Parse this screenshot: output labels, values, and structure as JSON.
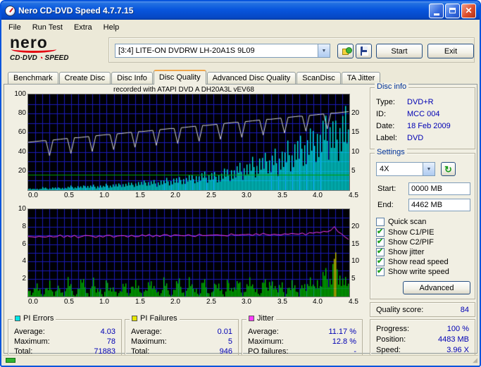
{
  "window": {
    "title": "Nero CD-DVD Speed 4.7.7.15"
  },
  "menu": {
    "items": [
      "File",
      "Run Test",
      "Extra",
      "Help"
    ]
  },
  "logo": {
    "brand": "nero",
    "product_prefix": "CD·DVD",
    "product_suffix": "SPEED"
  },
  "toolbar": {
    "drive_value": "[3:4]   LITE-ON DVDRW LH-20A1S 9L09",
    "start_label": "Start",
    "exit_label": "Exit"
  },
  "tabs": [
    {
      "label": "Benchmark"
    },
    {
      "label": "Create Disc"
    },
    {
      "label": "Disc Info"
    },
    {
      "label": "Disc Quality",
      "active": true
    },
    {
      "label": "Advanced Disc Quality"
    },
    {
      "label": "ScanDisc"
    },
    {
      "label": "TA Jitter"
    }
  ],
  "chart_header": "recorded with ATAPI   DVD A  DH20A3L   vEV68",
  "disc_info": {
    "title": "Disc info",
    "rows": [
      {
        "label": "Type:",
        "value": "DVD+R"
      },
      {
        "label": "ID:",
        "value": "MCC 004"
      },
      {
        "label": "Date:",
        "value": "18 Feb 2009"
      },
      {
        "label": "Label:",
        "value": "DVD"
      }
    ]
  },
  "settings": {
    "title": "Settings",
    "speed_value": "4X",
    "start_label": "Start:",
    "start_value": "0000 MB",
    "end_label": "End:",
    "end_value": "4462 MB",
    "checkboxes": [
      {
        "label": "Quick scan",
        "checked": false
      },
      {
        "label": "Show C1/PIE",
        "checked": true
      },
      {
        "label": "Show C2/PIF",
        "checked": true
      },
      {
        "label": "Show jitter",
        "checked": true
      },
      {
        "label": "Show read speed",
        "checked": true
      },
      {
        "label": "Show write speed",
        "checked": true
      }
    ],
    "advanced_label": "Advanced"
  },
  "quality": {
    "label": "Quality score:",
    "value": "84"
  },
  "stats": {
    "pi_errors": {
      "title": "PI Errors",
      "color": "#00E6E6",
      "rows": [
        [
          "Average:",
          "4.03"
        ],
        [
          "Maximum:",
          "78"
        ],
        [
          "Total:",
          "71883"
        ]
      ]
    },
    "pi_failures": {
      "title": "PI Failures",
      "color": "#E6E600",
      "rows": [
        [
          "Average:",
          "0.01"
        ],
        [
          "Maximum:",
          "5"
        ],
        [
          "Total:",
          "946"
        ]
      ]
    },
    "jitter": {
      "title": "Jitter",
      "color": "#FF3CFF",
      "rows": [
        [
          "Average:",
          "11.17 %"
        ],
        [
          "Maximum:",
          "12.8 %"
        ],
        [
          "PO failures:",
          "-"
        ]
      ]
    },
    "progress": {
      "rows": [
        [
          "Progress:",
          "100 %"
        ],
        [
          "Position:",
          "4483 MB"
        ],
        [
          "Speed:",
          "3.96 X"
        ]
      ]
    }
  },
  "chart_data": [
    {
      "type": "bar+line",
      "name": "pi_errors_and_speed",
      "x_range": [
        0,
        4.5
      ],
      "x_step": 0.05,
      "x_ticks": [
        "0.0",
        "0.5",
        "1.0",
        "1.5",
        "2.0",
        "2.5",
        "3.0",
        "3.5",
        "4.0",
        "4.5"
      ],
      "v_divs": 45,
      "h_divs": 10,
      "left_axis": {
        "max": 100,
        "ticks": [
          100,
          80,
          60,
          40,
          20
        ]
      },
      "right_axis": {
        "max": 25,
        "ticks": [
          20,
          15,
          10,
          5
        ]
      },
      "series": [
        {
          "name": "pi-errors-c1-pie",
          "type": "bars",
          "axis": "left",
          "color": "#00E6E6",
          "values": [
            2,
            1,
            2,
            1,
            3,
            2,
            2,
            3,
            2,
            3,
            2,
            3,
            4,
            3,
            4,
            3,
            5,
            4,
            5,
            4,
            5,
            4,
            6,
            5,
            6,
            5,
            7,
            6,
            7,
            6,
            7,
            8,
            7,
            9,
            8,
            9,
            8,
            10,
            9,
            11,
            10,
            12,
            10,
            13,
            11,
            14,
            12,
            15,
            13,
            16,
            14,
            17,
            15,
            18,
            16,
            20,
            17,
            22,
            19,
            24,
            21,
            26,
            23,
            28,
            25,
            31,
            27,
            34,
            29,
            37,
            32,
            40,
            35,
            44,
            38,
            48,
            42,
            52,
            45,
            56,
            48,
            60,
            52,
            65,
            55,
            70,
            58,
            66,
            74,
            78,
            45
          ]
        },
        {
          "name": "write-speed",
          "type": "line",
          "axis": "right",
          "color": "#D8D8D8",
          "values": [
            12.5,
            12.6,
            12.7,
            12.8,
            12.9,
            12.9,
            9.0,
            13.1,
            13.2,
            13.3,
            13.4,
            13.5,
            9.6,
            13.7,
            13.7,
            13.8,
            13.9,
            14.0,
            10.1,
            14.2,
            14.3,
            14.4,
            14.5,
            14.5,
            10.6,
            14.7,
            14.8,
            14.9,
            15.0,
            15.1,
            11.2,
            15.3,
            15.3,
            15.4,
            15.5,
            15.6,
            11.7,
            15.8,
            15.9,
            16.0,
            16.1,
            16.1,
            12.2,
            16.3,
            16.4,
            16.5,
            16.6,
            16.7,
            12.8,
            16.9,
            16.9,
            17.0,
            17.1,
            17.2,
            13.3,
            17.4,
            17.5,
            17.6,
            17.7,
            17.7,
            13.8,
            17.9,
            18.0,
            18.1,
            18.2,
            18.3,
            14.4,
            18.5,
            18.5,
            18.6,
            18.7,
            18.8,
            14.9,
            19.0,
            19.1,
            19.2,
            19.3,
            19.3,
            15.4,
            19.5,
            19.6,
            19.7,
            19.8,
            19.9,
            16.0,
            20.1,
            20.1,
            20.2,
            20.3,
            20.4,
            20.5
          ]
        },
        {
          "name": "read-speed",
          "type": "hline",
          "axis": "right",
          "color": "#00A000",
          "value": 4
        }
      ]
    },
    {
      "type": "bar+line",
      "name": "pi_failures_and_jitter",
      "x_range": [
        0,
        4.5
      ],
      "x_step": 0.05,
      "x_ticks": [
        "0.0",
        "0.5",
        "1.0",
        "1.5",
        "2.0",
        "2.5",
        "3.0",
        "3.5",
        "4.0",
        "4.5"
      ],
      "v_divs": 45,
      "h_divs": 10,
      "left_axis": {
        "max": 10,
        "ticks": [
          10,
          8,
          6,
          4,
          2
        ]
      },
      "right_axis": {
        "max": 25,
        "ticks": [
          20,
          15,
          10,
          5
        ]
      },
      "series": [
        {
          "name": "pi-failures-c2-pif",
          "type": "bars",
          "axis": "left",
          "color": "#00BE00",
          "highlight_threshold": 4,
          "highlight_color": "#C8C800",
          "values": [
            1,
            0,
            2,
            1,
            0,
            1,
            2,
            0,
            1,
            1,
            0,
            2,
            1,
            0,
            1,
            2,
            1,
            0,
            2,
            1,
            1,
            0,
            2,
            1,
            1,
            0,
            1,
            2,
            0,
            1,
            2,
            1,
            0,
            1,
            2,
            1,
            1,
            0,
            2,
            1,
            0,
            1,
            2,
            1,
            0,
            2,
            1,
            1,
            0,
            2,
            1,
            0,
            1,
            2,
            1,
            0,
            2,
            1,
            1,
            2,
            0,
            1,
            2,
            1,
            1,
            0,
            2,
            1,
            2,
            1,
            1,
            2,
            0,
            1,
            2,
            1,
            0,
            2,
            1,
            2,
            1,
            2,
            1,
            3,
            2,
            2,
            5,
            3,
            2,
            2,
            1
          ]
        },
        {
          "name": "jitter",
          "type": "line",
          "axis": "right",
          "scale_max": 16,
          "noise": 0.25,
          "color": "#FF3CFF",
          "values": [
            10.9,
            11.0,
            10.8,
            11.1,
            10.9,
            11.0,
            11.1,
            10.8,
            11.0,
            11.2,
            10.9,
            11.1,
            11.0,
            11.2,
            10.9,
            11.0,
            11.1,
            11.2,
            11.0,
            10.9,
            11.1,
            11.0,
            11.2,
            11.1,
            10.9,
            11.0,
            11.2,
            11.1,
            11.0,
            11.2,
            11.1,
            11.0,
            11.2,
            11.1,
            11.3,
            11.0,
            11.2,
            11.1,
            11.3,
            11.2,
            11.0,
            11.2,
            11.3,
            11.1,
            11.2,
            11.3,
            11.2,
            11.0,
            11.3,
            11.2,
            11.1,
            11.3,
            11.2,
            11.4,
            11.2,
            11.3,
            11.1,
            11.4,
            11.3,
            11.2,
            11.4,
            11.3,
            11.5,
            11.2,
            11.4,
            11.3,
            11.5,
            11.4,
            11.2,
            11.5,
            11.3,
            11.4,
            11.5,
            11.3,
            11.6,
            11.4,
            11.5,
            11.6,
            11.4,
            11.7,
            11.5,
            11.8,
            11.6,
            12.0,
            11.8,
            12.2,
            12.8,
            12.0,
            11.5,
            10.8,
            10.5
          ]
        }
      ]
    }
  ]
}
